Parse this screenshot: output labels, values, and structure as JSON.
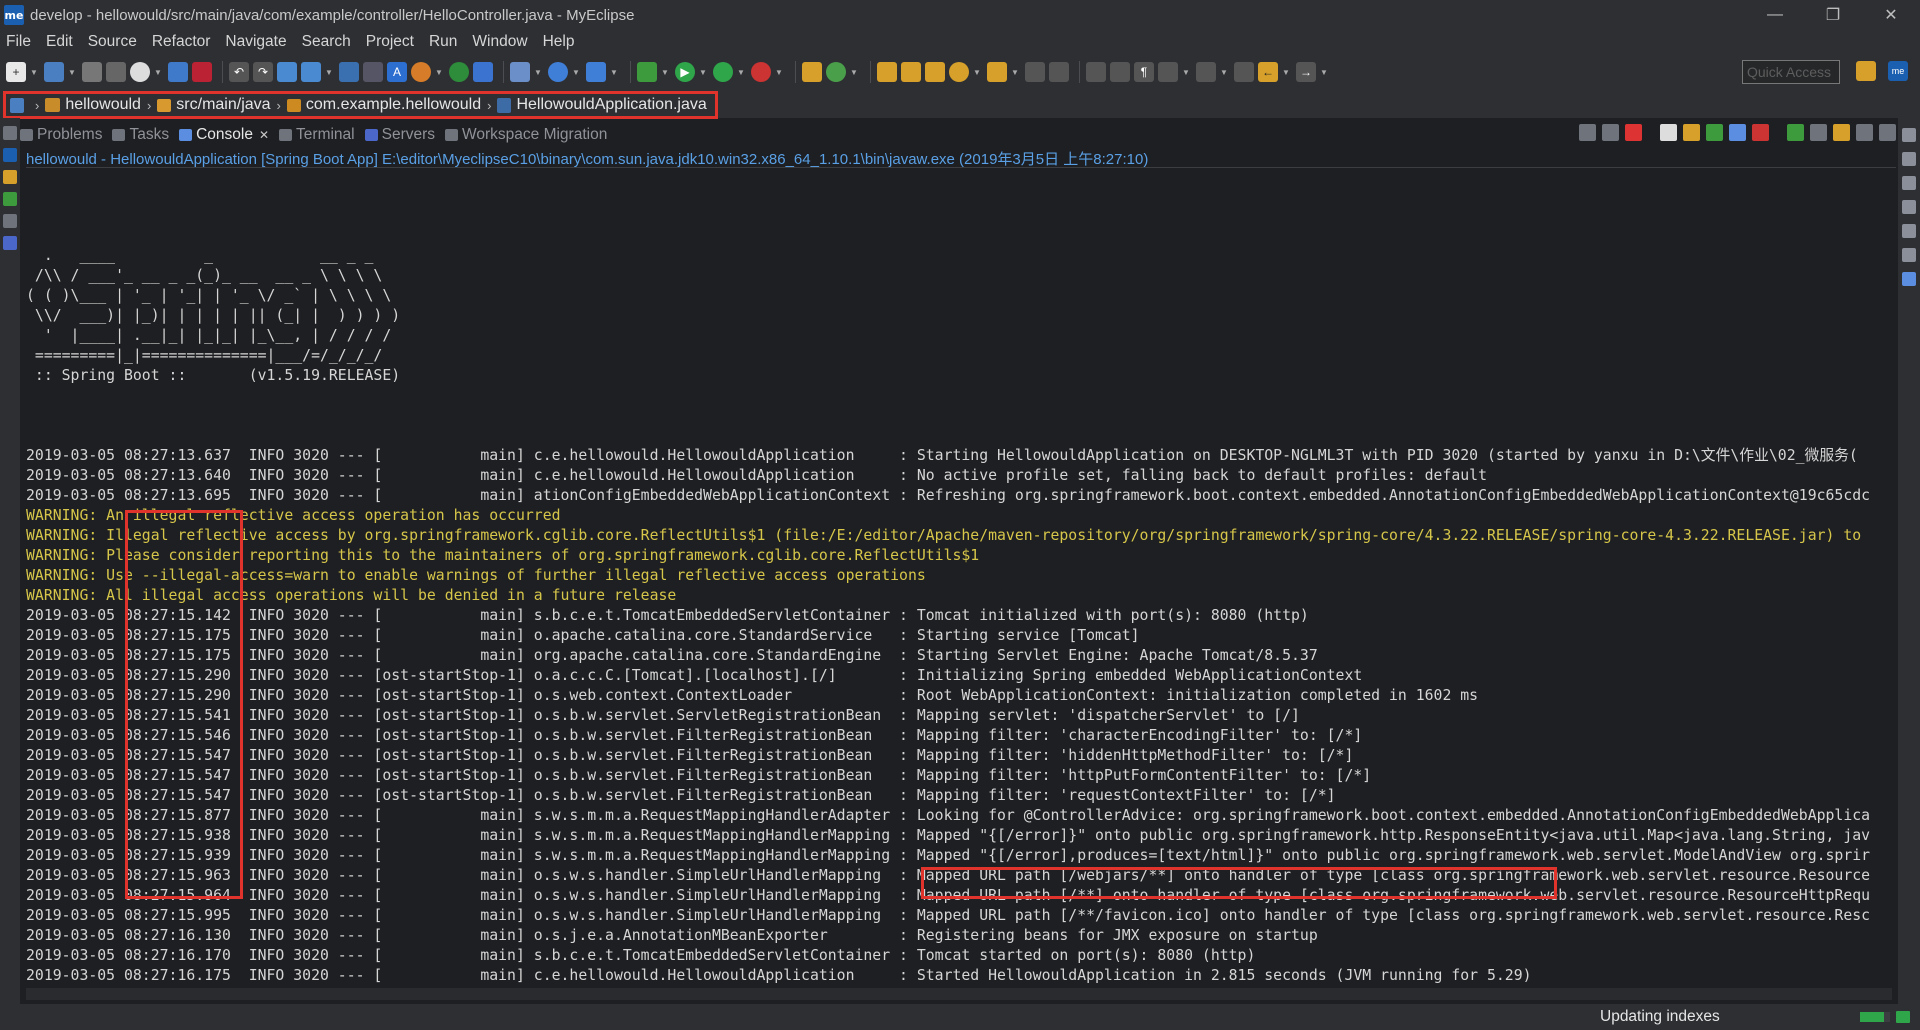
{
  "window": {
    "title": "develop - hellowould/src/main/java/com/example/controller/HelloController.java - MyEclipse",
    "app_logo_text": "me",
    "controls": [
      "minimize",
      "restore",
      "close"
    ]
  },
  "menu": [
    "File",
    "Edit",
    "Source",
    "Refactor",
    "Navigate",
    "Search",
    "Project",
    "Run",
    "Window",
    "Help"
  ],
  "toolbar": {
    "quick_access_placeholder": "Quick Access"
  },
  "breadcrumb": {
    "items": [
      {
        "label": "hellowould",
        "icon": "project-icon"
      },
      {
        "label": "src/main/java",
        "icon": "source-folder-icon"
      },
      {
        "label": "com.example.hellowould",
        "icon": "package-icon"
      },
      {
        "label": "HellowouldApplication.java",
        "icon": "java-file-icon"
      }
    ],
    "highlighted": true
  },
  "view_tabs": {
    "tabs": [
      {
        "label": "Problems",
        "active": false
      },
      {
        "label": "Tasks",
        "active": false
      },
      {
        "label": "Console",
        "active": true
      },
      {
        "label": "Terminal",
        "active": false
      },
      {
        "label": "Servers",
        "active": false
      },
      {
        "label": "Workspace Migration",
        "active": false
      }
    ],
    "close_symbol": "✕"
  },
  "console": {
    "header": "hellowould - HellowouldApplication [Spring Boot App] E:\\editor\\MyeclipseC10\\binary\\com.sun.java.jdk10.win32.x86_64_1.10.1\\bin\\javaw.exe (2019年3月5日 上午8:27:10)",
    "banner": [
      "",
      "  .   ____          _            __ _ _",
      " /\\\\ / ___'_ __ _ _(_)_ __  __ _ \\ \\ \\ \\",
      "( ( )\\___ | '_ | '_| | '_ \\/ _` | \\ \\ \\ \\",
      " \\\\/  ___)| |_)| | | | | || (_| |  ) ) ) )",
      "  '  |____| .__|_| |_|_| |_\\__, | / / / /",
      " =========|_|==============|___/=/_/_/_/",
      " :: Spring Boot ::       (v1.5.19.RELEASE)",
      ""
    ],
    "lines": [
      {
        "text": "2019-03-05 08:27:13.637  INFO 3020 --- [           main] c.e.hellowould.HellowouldApplication     : Starting HellowouldApplication on DESKTOP-NGLML3T with PID 3020 (started by yanxu in D:\\文件\\作业\\02_微服务(",
        "type": "info"
      },
      {
        "text": "2019-03-05 08:27:13.640  INFO 3020 --- [           main] c.e.hellowould.HellowouldApplication     : No active profile set, falling back to default profiles: default",
        "type": "info"
      },
      {
        "text": "2019-03-05 08:27:13.695  INFO 3020 --- [           main] ationConfigEmbeddedWebApplicationContext : Refreshing org.springframework.boot.context.embedded.AnnotationConfigEmbeddedWebApplicationContext@19c65cdc",
        "type": "info"
      },
      {
        "text": "WARNING: An illegal reflective access operation has occurred",
        "type": "warn"
      },
      {
        "text": "WARNING: Illegal reflective access by org.springframework.cglib.core.ReflectUtils$1 (file:/E:/editor/Apache/maven-repository/org/springframework/spring-core/4.3.22.RELEASE/spring-core-4.3.22.RELEASE.jar) to",
        "type": "warn"
      },
      {
        "text": "WARNING: Please consider reporting this to the maintainers of org.springframework.cglib.core.ReflectUtils$1",
        "type": "warn"
      },
      {
        "text": "WARNING: Use --illegal-access=warn to enable warnings of further illegal reflective access operations",
        "type": "warn"
      },
      {
        "text": "WARNING: All illegal access operations will be denied in a future release",
        "type": "warn"
      },
      {
        "text": "2019-03-05 08:27:15.142  INFO 3020 --- [           main] s.b.c.e.t.TomcatEmbeddedServletContainer : Tomcat initialized with port(s): 8080 (http)",
        "type": "info"
      },
      {
        "text": "2019-03-05 08:27:15.175  INFO 3020 --- [           main] o.apache.catalina.core.StandardService   : Starting service [Tomcat]",
        "type": "info"
      },
      {
        "text": "2019-03-05 08:27:15.175  INFO 3020 --- [           main] org.apache.catalina.core.StandardEngine  : Starting Servlet Engine: Apache Tomcat/8.5.37",
        "type": "info"
      },
      {
        "text": "2019-03-05 08:27:15.290  INFO 3020 --- [ost-startStop-1] o.a.c.c.C.[Tomcat].[localhost].[/]       : Initializing Spring embedded WebApplicationContext",
        "type": "info"
      },
      {
        "text": "2019-03-05 08:27:15.290  INFO 3020 --- [ost-startStop-1] o.s.web.context.ContextLoader            : Root WebApplicationContext: initialization completed in 1602 ms",
        "type": "info"
      },
      {
        "text": "2019-03-05 08:27:15.541  INFO 3020 --- [ost-startStop-1] o.s.b.w.servlet.ServletRegistrationBean  : Mapping servlet: 'dispatcherServlet' to [/]",
        "type": "info"
      },
      {
        "text": "2019-03-05 08:27:15.546  INFO 3020 --- [ost-startStop-1] o.s.b.w.servlet.FilterRegistrationBean   : Mapping filter: 'characterEncodingFilter' to: [/*]",
        "type": "info"
      },
      {
        "text": "2019-03-05 08:27:15.547  INFO 3020 --- [ost-startStop-1] o.s.b.w.servlet.FilterRegistrationBean   : Mapping filter: 'hiddenHttpMethodFilter' to: [/*]",
        "type": "info"
      },
      {
        "text": "2019-03-05 08:27:15.547  INFO 3020 --- [ost-startStop-1] o.s.b.w.servlet.FilterRegistrationBean   : Mapping filter: 'httpPutFormContentFilter' to: [/*]",
        "type": "info"
      },
      {
        "text": "2019-03-05 08:27:15.547  INFO 3020 --- [ost-startStop-1] o.s.b.w.servlet.FilterRegistrationBean   : Mapping filter: 'requestContextFilter' to: [/*]",
        "type": "info"
      },
      {
        "text": "2019-03-05 08:27:15.877  INFO 3020 --- [           main] s.w.s.m.m.a.RequestMappingHandlerAdapter : Looking for @ControllerAdvice: org.springframework.boot.context.embedded.AnnotationConfigEmbeddedWebApplica",
        "type": "info"
      },
      {
        "text": "2019-03-05 08:27:15.938  INFO 3020 --- [           main] s.w.s.m.m.a.RequestMappingHandlerMapping : Mapped \"{[/error]}\" onto public org.springframework.http.ResponseEntity<java.util.Map<java.lang.String, jav",
        "type": "info"
      },
      {
        "text": "2019-03-05 08:27:15.939  INFO 3020 --- [           main] s.w.s.m.m.a.RequestMappingHandlerMapping : Mapped \"{[/error],produces=[text/html]}\" onto public org.springframework.web.servlet.ModelAndView org.sprir",
        "type": "info"
      },
      {
        "text": "2019-03-05 08:27:15.963  INFO 3020 --- [           main] o.s.w.s.handler.SimpleUrlHandlerMapping  : Mapped URL path [/webjars/**] onto handler of type [class org.springframework.web.servlet.resource.Resource",
        "type": "info"
      },
      {
        "text": "2019-03-05 08:27:15.964  INFO 3020 --- [           main] o.s.w.s.handler.SimpleUrlHandlerMapping  : Mapped URL path [/**] onto handler of type [class org.springframework.web.servlet.resource.ResourceHttpRequ",
        "type": "info"
      },
      {
        "text": "2019-03-05 08:27:15.995  INFO 3020 --- [           main] o.s.w.s.handler.SimpleUrlHandlerMapping  : Mapped URL path [/**/favicon.ico] onto handler of type [class org.springframework.web.servlet.resource.Resc",
        "type": "info"
      },
      {
        "text": "2019-03-05 08:27:16.130  INFO 3020 --- [           main] o.s.j.e.a.AnnotationMBeanExporter        : Registering beans for JMX exposure on startup",
        "type": "info"
      },
      {
        "text": "2019-03-05 08:27:16.170  INFO 3020 --- [           main] s.b.c.e.t.TomcatEmbeddedServletContainer : Tomcat started on port(s): 8080 (http)",
        "type": "info"
      },
      {
        "text": "2019-03-05 08:27:16.175  INFO 3020 --- [           main] c.e.hellowould.HellowouldApplication     : Started HellowouldApplication in 2.815 seconds (JVM running for 5.29)",
        "type": "info"
      }
    ]
  },
  "status": {
    "text": "Updating indexes",
    "progress_fraction": 0.8
  },
  "colors": {
    "highlight_box": "#e0332b",
    "warning_text": "#d6c64a",
    "header_link": "#5aa0e6",
    "progress": "#2fa64a"
  }
}
